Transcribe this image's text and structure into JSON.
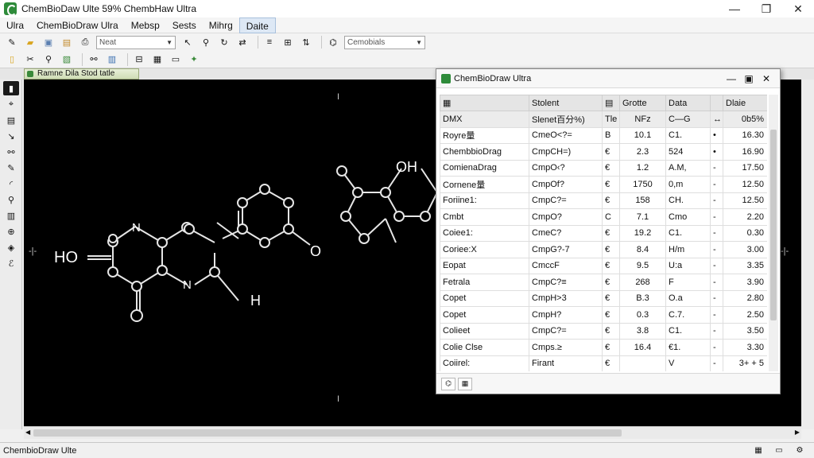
{
  "window": {
    "title": "ChemBioDaw Ulte 59% ChembHaw Ultra",
    "controls": [
      "—",
      "❐",
      "✕"
    ]
  },
  "menu": {
    "items": [
      "Ulra",
      "ChemBioDraw Ulra",
      "Mebsp",
      "Sests",
      "Mihrg",
      "Daite"
    ]
  },
  "toolbar": {
    "combo1_value": "Neat",
    "combo2_value": "Cemobials"
  },
  "doc_tab": {
    "label": "Ramne Dila Stod tatle"
  },
  "canvas": {
    "labels": {
      "ho": "HO",
      "n1": "N",
      "n2": "N",
      "h": "H",
      "oh": "OH",
      "o": "O",
      "cursor_top": "I",
      "cursor_bottom": "I",
      "left_mark": "-|-",
      "right_mark": "-|-"
    }
  },
  "panel": {
    "title": "ChemBioDraw Ultra",
    "columns": [
      "",
      "Stolent",
      "",
      "Grotte",
      "Data",
      "",
      "Dlaie"
    ],
    "subheader": [
      "DMX",
      "Slenet百分%)",
      "Tle",
      "NFz",
      "C—G",
      "↔",
      "0b5%"
    ],
    "rows": [
      [
        "Royre量",
        "CmeO<?=",
        "B",
        "10.1",
        "C1.",
        "•",
        "16.30"
      ],
      [
        "ChembbioDrag",
        "CmpCH=)",
        "€",
        "2.3",
        "524",
        "•",
        "16.90"
      ],
      [
        "ComienaDrag",
        "CmpO‹?",
        "€",
        "1.2",
        "A.M,",
        "-",
        "17.50"
      ],
      [
        "Cornene量",
        "CmpOf?",
        "€",
        "1750",
        "0,m",
        "-",
        "12.50"
      ],
      [
        "Foriine1:",
        "CmpC?=",
        "€",
        "158",
        "CH.",
        "-",
        "12.50"
      ],
      [
        "Cmbt",
        "CmpO?",
        "C",
        "7.1",
        "Cmo",
        "-",
        "2.20"
      ],
      [
        "Coiee1:",
        "CmeC?",
        "€",
        "19.2",
        "C1.",
        "-",
        "0.30"
      ],
      [
        "Coriee:X",
        "CmpG?-7",
        "€",
        "8.4",
        "H/m",
        "-",
        "3.00"
      ],
      [
        "Eopat",
        "CmccF",
        "€",
        "9.5",
        "U:a",
        "-",
        "3.35"
      ],
      [
        "Fetrala",
        "CmpC?≡",
        "€",
        "268",
        "F",
        "-",
        "3.90"
      ],
      [
        "Copet",
        "CmpH>3",
        "€",
        "B.3",
        "O.a",
        "-",
        "2.80"
      ],
      [
        "Copet",
        "CmpH?",
        "€",
        "0.3",
        "C.7.",
        "-",
        "2.50"
      ],
      [
        "Colieet",
        "CmpC?=",
        "€",
        "3.8",
        "C1.",
        "-",
        "3.50"
      ],
      [
        "Colie Clse",
        "Cmps.≥",
        "€",
        "16.4",
        "€1.",
        "-",
        "3.30"
      ],
      [
        "Coiirel:",
        "Firant",
        "€",
        "",
        "V",
        "-",
        "3+ + 5"
      ]
    ]
  },
  "status": {
    "text": "ChembioDraw Ulte"
  }
}
